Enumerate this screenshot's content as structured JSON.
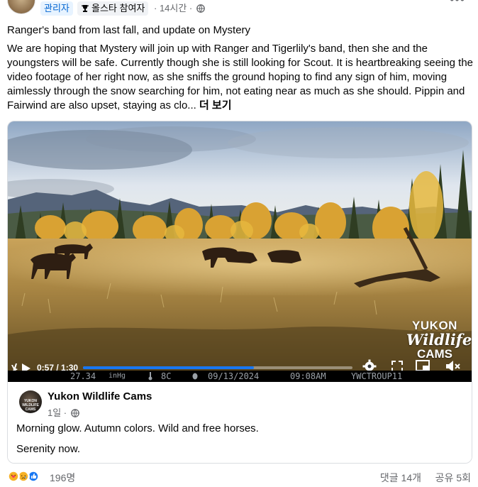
{
  "header": {
    "admin_badge": "관리자",
    "star_badge": "올스타 참여자",
    "time": "· 14시간 ·",
    "more_label": "•••"
  },
  "post": {
    "title": "Ranger's band from last fall, and update on Mystery",
    "body": "We are hoping that Mystery will join up with Ranger and Tigerlily's band, then she and the youngsters will be safe. Currently though she is still looking for Scout. It is heartbreaking seeing the video footage of her right now, as she sniffs the ground hoping to find any sign of him, moving aimlessly through the snow searching for him, not eating near as much as she should. Pippin and Fairwind are also upset, staying as clo...",
    "see_more": "더 보기"
  },
  "video": {
    "watermark_line1": "YUKON",
    "watermark_line2": "Wildlife",
    "watermark_line3": "CAMS",
    "time_display": "0:57 / 1:30",
    "progress": 0.633,
    "info": {
      "pressure": "27.34",
      "pressure_unit": "inHg",
      "temperature": "8C",
      "date": "09/13/2024",
      "clock": "09:08AM",
      "camera_id": "YWCTROUP11"
    }
  },
  "shared_page": {
    "avatar_label": "YUKON WILDLIFE CAMS",
    "name": "Yukon Wildlife Cams",
    "meta": "1일 ·",
    "text1": "Morning glow. Autumn colors. Wild and free horses.",
    "text2": "Serenity now."
  },
  "footer": {
    "reaction_count": "196명",
    "comments": "댓글 14개",
    "shares": "공유 5회"
  },
  "colors": {
    "accent": "#1877f2",
    "muted_text": "#65676b",
    "badge_blue_bg": "#e7f3ff"
  }
}
